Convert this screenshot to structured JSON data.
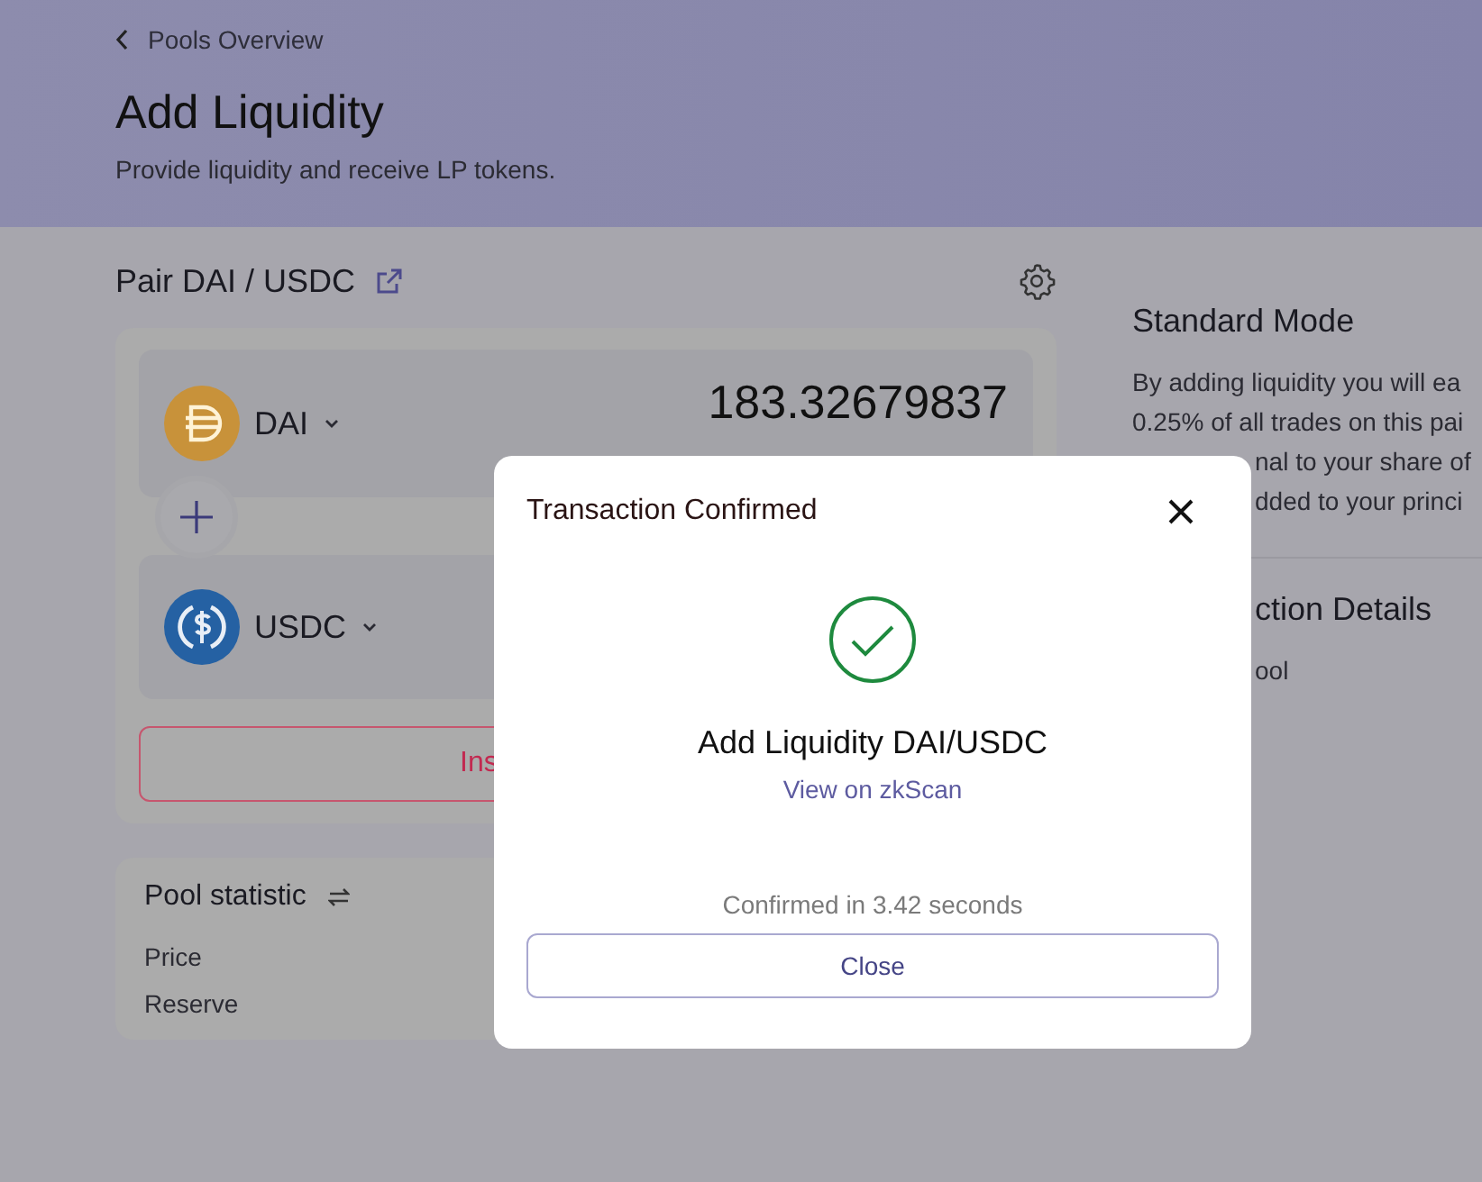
{
  "back_link": {
    "label": "Pools Overview"
  },
  "header": {
    "title": "Add Liquidity",
    "subtitle": "Provide liquidity and receive LP tokens."
  },
  "pair": {
    "title": "Pair DAI / USDC"
  },
  "tokens": [
    {
      "symbol": "DAI",
      "kind": "dai",
      "amount": "183.32679837"
    },
    {
      "symbol": "USDC",
      "kind": "usdc"
    }
  ],
  "action_button": {
    "label": "Ins"
  },
  "pool_statistic": {
    "title": "Pool statistic",
    "rows": [
      "Price",
      "Reserve"
    ]
  },
  "standard_mode": {
    "title": "Standard Mode",
    "lines": [
      {
        "text": "By adding liquidity you will ea",
        "covered": false
      },
      {
        "text": "0.25% of all trades on this pai",
        "covered": false
      },
      {
        "text": "nal to your share of",
        "covered": true
      },
      {
        "text": "dded to your princi",
        "covered": true
      }
    ]
  },
  "details": {
    "title": {
      "text": "ction Details",
      "covered": true
    },
    "rows": [
      {
        "text": "ool",
        "covered": true
      }
    ]
  },
  "dialog": {
    "title": "Transaction Confirmed",
    "heading": "Add Liquidity DAI/USDC",
    "link": "View on zkScan",
    "status": "Confirmed in 3.42 seconds",
    "button": "Close"
  }
}
